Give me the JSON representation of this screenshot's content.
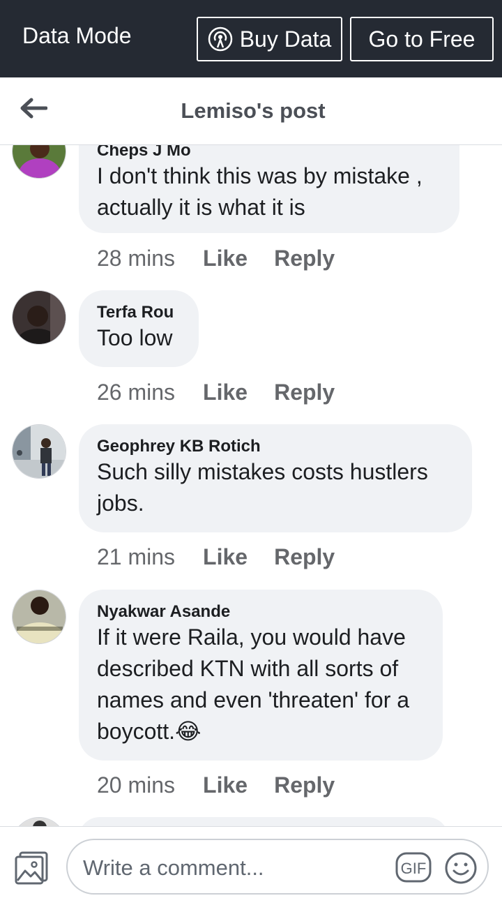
{
  "databar": {
    "mode_label": "Data Mode",
    "buy_label": "Buy Data",
    "free_label": "Go to Free",
    "bg_color": "#252a33"
  },
  "header": {
    "title": "Lemiso's post",
    "back_icon": "back-arrow-icon"
  },
  "comments": [
    {
      "author": "Cheps J Mo",
      "text": "I don't think this was by mistake , actually it is what it is",
      "time": "28 mins",
      "like_label": "Like",
      "reply_label": "Reply"
    },
    {
      "author": "Terfa Rou",
      "text": "Too low",
      "time": "26 mins",
      "like_label": "Like",
      "reply_label": "Reply"
    },
    {
      "author": "Geophrey KB Rotich",
      "text": "Such silly mistakes costs hustlers jobs.",
      "time": "21 mins",
      "like_label": "Like",
      "reply_label": "Reply"
    },
    {
      "author": "Nyakwar Asande",
      "text": "If it were Raila, you would have described KTN with all sorts of names and even 'threaten' for a boycott.",
      "emoji": "😂",
      "time": "20 mins",
      "like_label": "Like",
      "reply_label": "Reply"
    }
  ],
  "composer": {
    "placeholder": "Write a comment...",
    "gif_label": "GIF",
    "photo_icon": "photo-icon",
    "emoji_icon": "smiley-icon"
  }
}
